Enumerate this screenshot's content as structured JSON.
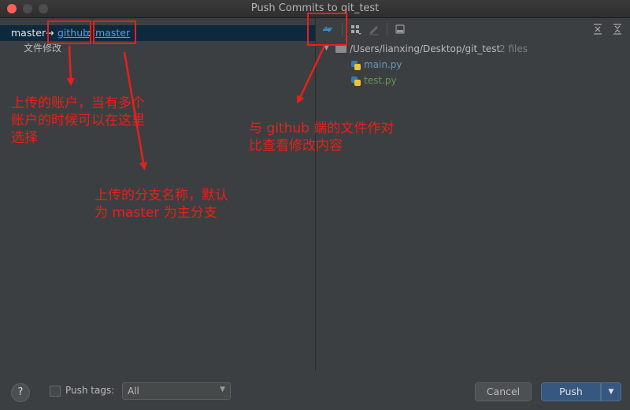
{
  "window": {
    "title": "Push Commits to git_test"
  },
  "branch": {
    "local": "master",
    "arrow": "→",
    "remote": "github",
    "separator": ":",
    "target": "master"
  },
  "commit": {
    "message": "文件修改"
  },
  "tree": {
    "folder": "/Users/lianxing/Desktop/git_test",
    "count": "2 files",
    "files": [
      {
        "name": "main.py"
      },
      {
        "name": "test.py"
      }
    ]
  },
  "footer": {
    "push_tags_label": "Push tags:",
    "tags_value": "All",
    "cancel": "Cancel",
    "push": "Push",
    "help": "?"
  },
  "annotations": {
    "account_note": "上传的账户，当有多个\n账户的时候可以在这里\n选择",
    "branch_note": "上传的分支名称，默认\n为 master 为主分支",
    "compare_note": "与 github 端的文件作对\n比查看修改内容"
  },
  "colors": {
    "accent": "#589df6",
    "annotation": "#e8201a",
    "push_button": "#365880",
    "selected_row": "#0d293e"
  }
}
